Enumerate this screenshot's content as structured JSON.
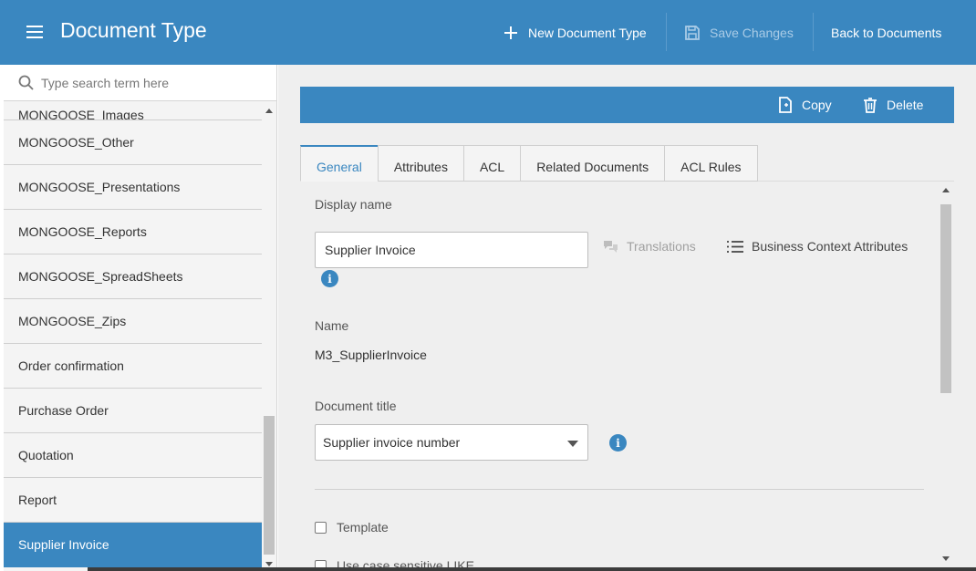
{
  "header": {
    "title": "Document Type",
    "new_label": "New Document Type",
    "save_label": "Save Changes",
    "back_label": "Back to Documents"
  },
  "sidebar": {
    "search_placeholder": "Type search term here",
    "items": [
      {
        "label": "MONGOOSE_Images"
      },
      {
        "label": "MONGOOSE_Other"
      },
      {
        "label": "MONGOOSE_Presentations"
      },
      {
        "label": "MONGOOSE_Reports"
      },
      {
        "label": "MONGOOSE_SpreadSheets"
      },
      {
        "label": "MONGOOSE_Zips"
      },
      {
        "label": "Order confirmation"
      },
      {
        "label": "Purchase Order"
      },
      {
        "label": "Quotation"
      },
      {
        "label": "Report"
      },
      {
        "label": "Supplier Invoice",
        "selected": true
      }
    ]
  },
  "actions": {
    "copy_label": "Copy",
    "delete_label": "Delete"
  },
  "tabs": [
    {
      "label": "General",
      "active": true
    },
    {
      "label": "Attributes"
    },
    {
      "label": "ACL"
    },
    {
      "label": "Related Documents"
    },
    {
      "label": "ACL Rules"
    }
  ],
  "form": {
    "display_name_label": "Display name",
    "display_name_value": "Supplier Invoice",
    "translations_label": "Translations",
    "business_context_label": "Business Context Attributes",
    "name_label": "Name",
    "name_value": "M3_SupplierInvoice",
    "doc_title_label": "Document title",
    "doc_title_value": "Supplier invoice number",
    "template_label": "Template",
    "case_sensitive_label": "Use case sensitive LIKE"
  },
  "colors": {
    "primary": "#3a87c0",
    "background": "#efefef",
    "sidebar": "#f4f4f4"
  }
}
